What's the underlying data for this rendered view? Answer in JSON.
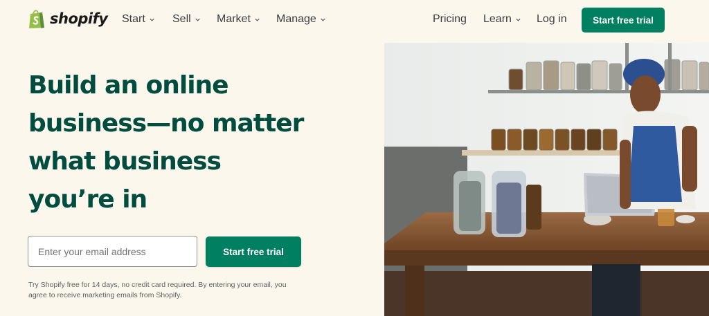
{
  "brand": {
    "name": "shopify",
    "logo_icon": "shopping-bag-icon",
    "logo_color": "#95bf47"
  },
  "nav": {
    "items": [
      {
        "label": "Start",
        "dropdown": true
      },
      {
        "label": "Sell",
        "dropdown": true
      },
      {
        "label": "Market",
        "dropdown": true
      },
      {
        "label": "Manage",
        "dropdown": true
      }
    ],
    "pricing": "Pricing",
    "learn": "Learn",
    "login": "Log in",
    "cta": "Start free trial"
  },
  "hero": {
    "headline": [
      "Build an online",
      "business—no matter",
      "what business",
      "you’re in"
    ],
    "email_placeholder": "Enter your email address",
    "email_value": "",
    "cta": "Start free trial",
    "disclaimer": "Try Shopify free for 14 days, no credit card required. By entering your email, you agree to receive marketing emails from Shopify."
  },
  "colors": {
    "accent": "#008060",
    "headline": "#004c3f",
    "background": "#fbf7ed"
  }
}
